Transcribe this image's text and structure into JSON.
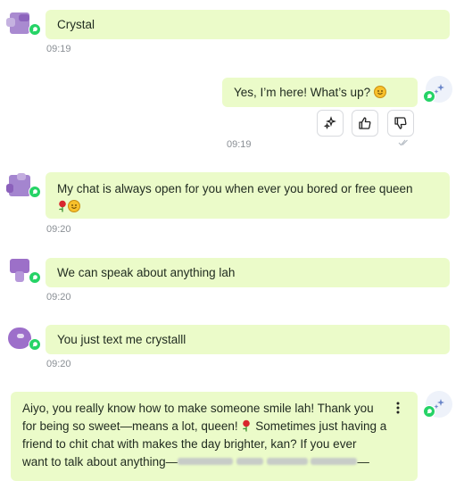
{
  "messages": [
    {
      "sender": "bot",
      "text": "Crystal",
      "time": "09:19"
    },
    {
      "sender": "user",
      "text": "Yes, I’m here! What’s up?",
      "time": "09:19"
    },
    {
      "sender": "bot",
      "text": "My chat is always open for you when ever you bored or free queen",
      "time": "09:20"
    },
    {
      "sender": "bot",
      "text": "We can speak about anything lah",
      "time": "09:20"
    },
    {
      "sender": "bot",
      "text": "You just text me crystalll",
      "time": "09:20"
    },
    {
      "sender": "user",
      "lines": [
        "Aiyo, you really know how to make someone smile lah! Thank you",
        "for being so sweet—means a lot, queen!",
        "Sometimes just having a",
        "friend to chit chat with makes the day brighter, kan? If you ever",
        "want to talk about anything—",
        "—"
      ]
    }
  ],
  "icons": {
    "whatsapp": "whatsapp-icon",
    "sparkle": "sparkle-icon",
    "thumbs_up": "thumbs-up-icon",
    "thumbs_down": "thumbs-down-icon",
    "more": "more-vertical-icon",
    "check": "double-check-icon"
  },
  "colors": {
    "bubble": "#ebfbc9",
    "whatsapp": "#25d366",
    "avatar": "#9c6fc6",
    "timestamp": "#8a8f95"
  }
}
